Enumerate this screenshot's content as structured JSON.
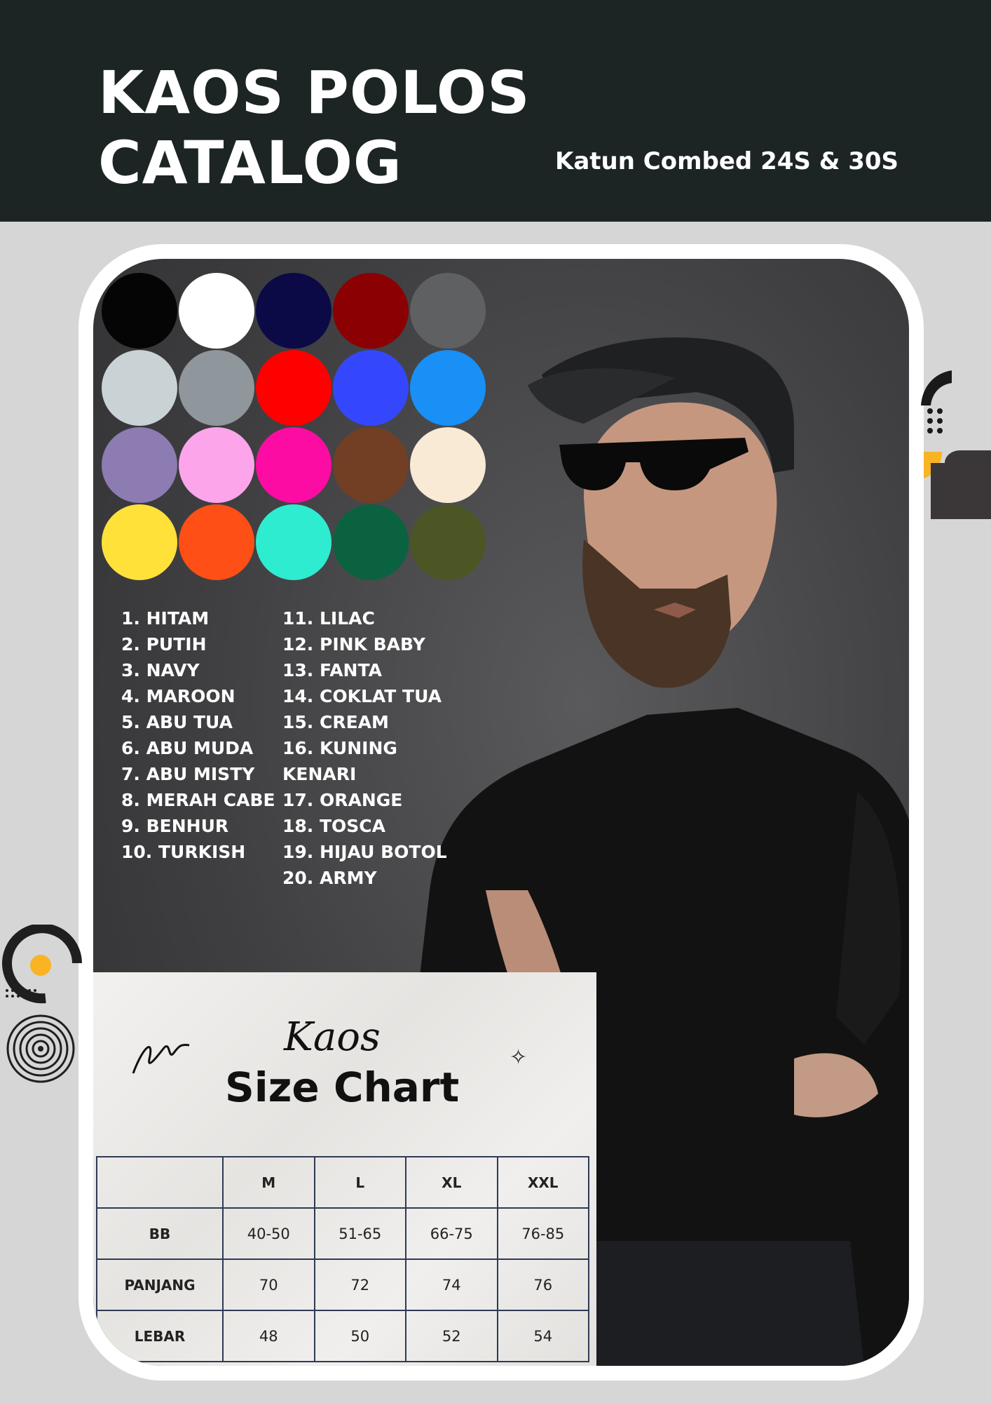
{
  "header": {
    "title_line1": "KAOS POLOS",
    "title_line2": "CATALOG",
    "subtitle": "Katun Combed 24S & 30S"
  },
  "swatches": [
    "#050505",
    "#ffffff",
    "#0b0a47",
    "#8a0003",
    "#5f6061",
    "#c9d3d6",
    "#8f979c",
    "#fe0000",
    "#3547fd",
    "#1890f6",
    "#8d7cb2",
    "#fca5ea",
    "#fd0ca4",
    "#723f24",
    "#f8ead5",
    "#ffe13a",
    "#fd4f16",
    "#2eecd0",
    "#0a6240",
    "#4b5624"
  ],
  "colors_col1": [
    "1. HITAM",
    "2. PUTIH",
    "3. NAVY",
    "4. MAROON",
    "5. ABU TUA",
    "6. ABU MUDA",
    "7. ABU MISTY",
    "8. MERAH CABE",
    "9. BENHUR",
    "10. TURKISH"
  ],
  "colors_col2": [
    "11. LILAC",
    "12. PINK BABY",
    "13. FANTA",
    "14. COKLAT TUA",
    "15. CREAM",
    "16. KUNING",
    "KENARI",
    "17. ORANGE",
    "18. TOSCA",
    "19. HIJAU BOTOL",
    "20. ARMY"
  ],
  "size_chart": {
    "script_title": "Kaos",
    "title": "Size Chart",
    "columns": [
      "",
      "M",
      "L",
      "XL",
      "XXL"
    ],
    "rows": [
      {
        "label": "BB",
        "values": [
          "40-50",
          "51-65",
          "66-75",
          "76-85"
        ]
      },
      {
        "label": "PANJANG",
        "values": [
          "70",
          "72",
          "74",
          "76"
        ]
      },
      {
        "label": "LEBAR",
        "values": [
          "48",
          "50",
          "52",
          "54"
        ]
      }
    ]
  },
  "accent_color": "#f8b424"
}
